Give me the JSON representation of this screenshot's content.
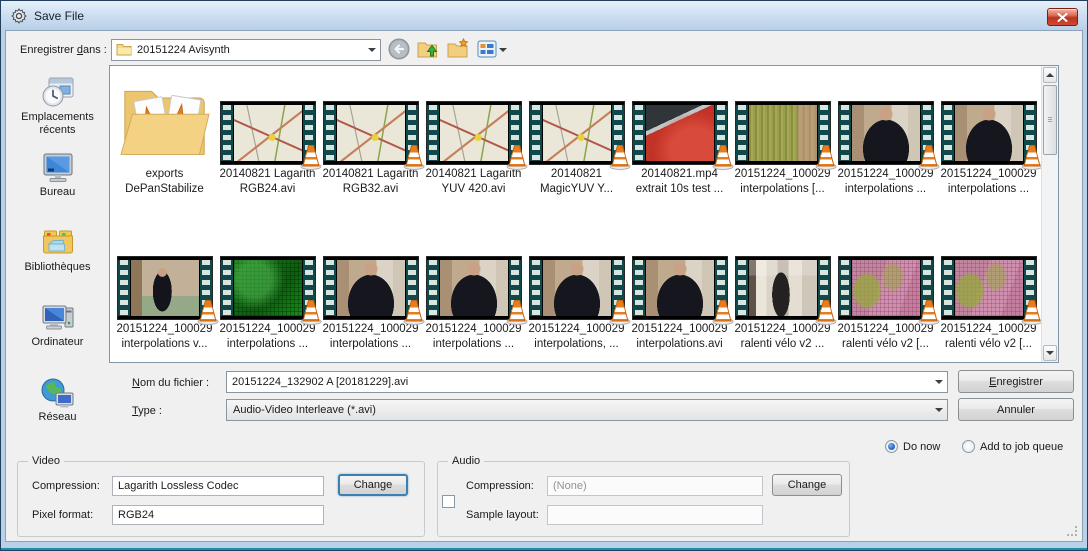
{
  "window": {
    "title": "Save File"
  },
  "toolbar": {
    "look_in_label": "Enregistrer &dans :",
    "folder_value": "20151224 Avisynth",
    "buttons": [
      {
        "name": "back",
        "icon": "back"
      },
      {
        "name": "up-one-level",
        "icon": "up-folder"
      },
      {
        "name": "create-new-folder",
        "icon": "new-folder"
      },
      {
        "name": "view-menu",
        "icon": "views",
        "caret": true
      }
    ]
  },
  "sidebar": {
    "items": [
      {
        "label": "Emplacements récents",
        "icon": "recent-places"
      },
      {
        "label": "Bureau",
        "icon": "desktop"
      },
      {
        "label": "Bibliothèques",
        "icon": "libraries"
      },
      {
        "label": "Ordinateur",
        "icon": "computer"
      },
      {
        "label": "Réseau",
        "icon": "network"
      }
    ]
  },
  "files": {
    "rows": [
      [
        {
          "type": "folder",
          "line1": "exports",
          "line2": "DePanStabilize"
        },
        {
          "type": "map",
          "line1": "20140821 Lagarith",
          "line2": "RGB24.avi"
        },
        {
          "type": "map",
          "line1": "20140821 Lagarith",
          "line2": "RGB32.avi"
        },
        {
          "type": "map",
          "line1": "20140821 Lagarith",
          "line2": "YUV 420.avi"
        },
        {
          "type": "map",
          "line1": "20140821",
          "line2": "MagicYUV Y..."
        },
        {
          "type": "car",
          "line1": "20140821.mp4",
          "line2": "extrait 10s test ..."
        },
        {
          "type": "olive",
          "line1": "20151224_100029",
          "line2": "interpolations [..."
        },
        {
          "type": "person",
          "line1": "20151224_100029",
          "line2": "interpolations ..."
        },
        {
          "type": "person",
          "line1": "20151224_100029",
          "line2": "interpolations ..."
        }
      ],
      [
        {
          "type": "person-full",
          "line1": "20151224_100029",
          "line2": "interpolations v..."
        },
        {
          "type": "green",
          "line1": "20151224_100029",
          "line2": "interpolations ..."
        },
        {
          "type": "person",
          "line1": "20151224_100029",
          "line2": "interpolations ..."
        },
        {
          "type": "person",
          "line1": "20151224_100029",
          "line2": "interpolations ..."
        },
        {
          "type": "person",
          "line1": "20151224_100029",
          "line2": "interpolations, ..."
        },
        {
          "type": "person",
          "line1": "20151224_100029",
          "line2": "interpolations.avi"
        },
        {
          "type": "hallway",
          "line1": "20151224_100029",
          "line2": "ralenti vélo v2 ..."
        },
        {
          "type": "pink",
          "line1": "20151224_100029",
          "line2": "ralenti vélo v2 [..."
        },
        {
          "type": "pink",
          "line1": "20151224_100029",
          "line2": "ralenti vélo v2 [..."
        }
      ]
    ]
  },
  "fields": {
    "filename_label": "&Nom du fichier :",
    "filename_value": "20151224_132902 A [20181229].avi",
    "type_label": "&Type :",
    "type_value": "Audio-Video Interleave (*.avi)"
  },
  "actions": {
    "save_label": "&Enregistrer",
    "cancel_label": "Annuler"
  },
  "queue": {
    "do_now_label": "Do now",
    "add_to_queue_label": "Add to job queue",
    "selected": "do_now"
  },
  "video": {
    "group_label": "Video",
    "compression_label": "Compression:",
    "compression_value": "Lagarith Lossless Codec",
    "change_label": "Change",
    "pixel_format_label": "Pixel format:",
    "pixel_format_value": "RGB24"
  },
  "audio": {
    "group_label": "Audio",
    "enabled": false,
    "compression_label": "Compression:",
    "compression_value": "(None)",
    "change_label": "Change",
    "sample_layout_label": "Sample layout:",
    "sample_layout_value": ""
  },
  "colors": {
    "titlebar_top": "#e6f0fb",
    "titlebar_bottom": "#b9cfe8",
    "frame_blue": "#b9d1e8",
    "client_bg": "#f0f0f0",
    "close_red": "#b83520",
    "radio_selected_blue": "#2a66c8",
    "film_sprocket_teal": "#11484b"
  }
}
